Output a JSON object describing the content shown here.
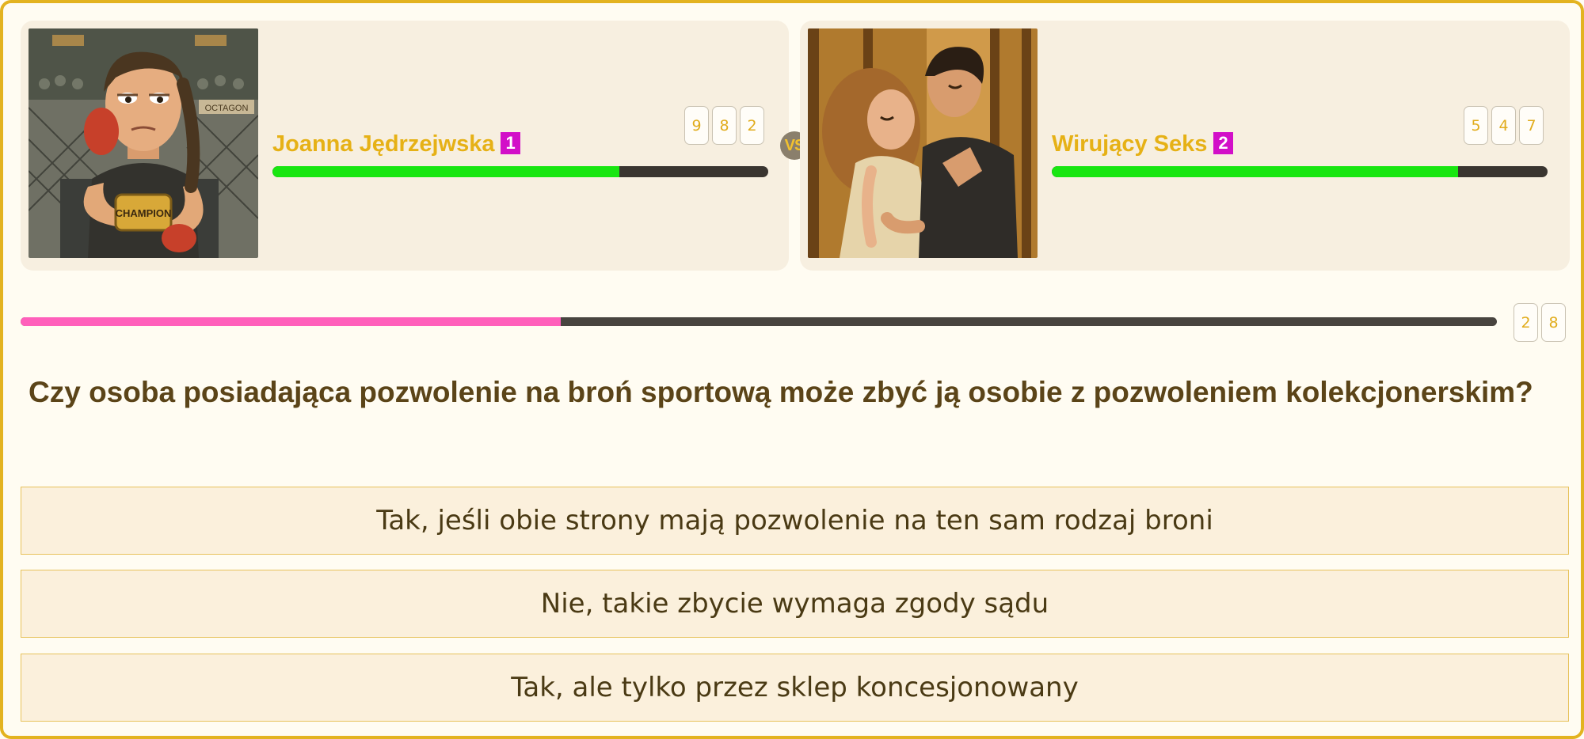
{
  "player1": {
    "name": "Joanna Jędrzejwska",
    "rank": "1",
    "score_digits": [
      "9",
      "8",
      "2"
    ],
    "hp_fraction": 0.7,
    "avatar_texts": {
      "belt": "CHAMPION",
      "sign": "OCTAGON"
    }
  },
  "vs_label": "VS",
  "player2": {
    "name": "Wirujący Seks",
    "rank": "2",
    "score_digits": [
      "5",
      "4",
      "7"
    ],
    "hp_fraction": 0.82
  },
  "timer": {
    "fraction": 0.366,
    "digits": [
      "2",
      "8"
    ]
  },
  "question": "Czy osoba posiadająca pozwolenie na broń sportową może zbyć ją osobie z pozwoleniem kolekcjonerskim?",
  "answers": [
    "Tak, jeśli obie strony mają pozwolenie na ten sam rodzaj broni",
    "Nie, takie zbycie wymaga zgody sądu",
    "Tak, ale tylko przez sklep koncesjonowany"
  ],
  "colors": {
    "hp_green": "#19e611",
    "timer_pink": "#ff5fbb",
    "name_gold": "#e6b116",
    "rank_magenta": "#d20fc8"
  }
}
